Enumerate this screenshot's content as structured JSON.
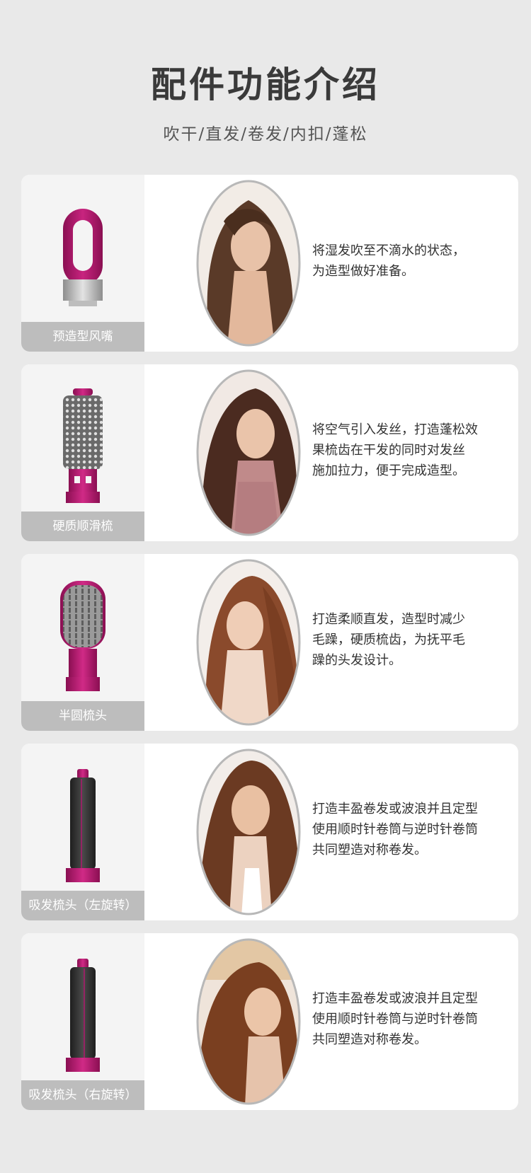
{
  "header": {
    "title": "配件功能介绍",
    "subtitle": "吹干/直发/卷发/内扣/蓬松"
  },
  "accessories": [
    {
      "label": "预造型风嘴",
      "description": "将湿发吹至不滴水的状态，\n为造型做好准备。"
    },
    {
      "label": "硬质顺滑梳",
      "description": "将空气引入发丝，打造蓬松效\n果梳齿在干发的同时对发丝\n施加拉力，便于完成造型。"
    },
    {
      "label": "半圆梳头",
      "description": "打造柔顺直发，造型时减少\n毛躁，硬质梳齿，为抚平毛\n躁的头发设计。"
    },
    {
      "label": "吸发梳头（左旋转）",
      "description": "打造丰盈卷发或波浪并且定型\n使用顺时针卷筒与逆时针卷筒\n共同塑造对称卷发。"
    },
    {
      "label": "吸发梳头（右旋转）",
      "description": "打造丰盈卷发或波浪并且定型\n使用顺时针卷筒与逆时针卷筒\n共同塑造对称卷发。"
    }
  ],
  "colors": {
    "accent": "#b0196e",
    "label_bg": "#bdbdbd",
    "page_bg": "#e9e9e9"
  }
}
